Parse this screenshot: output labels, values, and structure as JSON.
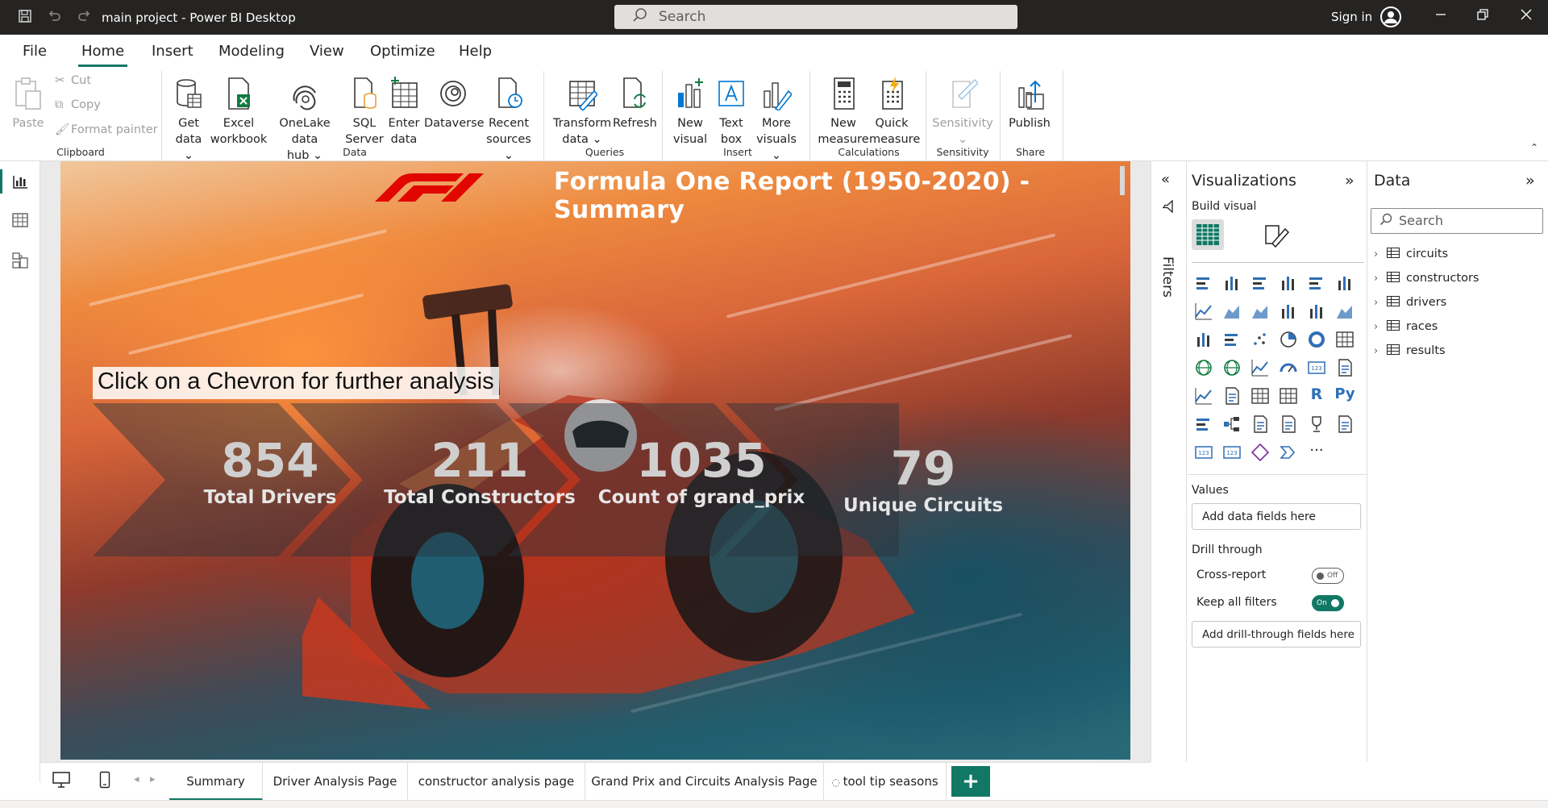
{
  "titlebar": {
    "title": "main project - Power BI Desktop",
    "search_placeholder": "Search",
    "signin": "Sign in"
  },
  "menu": {
    "tabs": [
      "File",
      "Home",
      "Insert",
      "Modeling",
      "View",
      "Optimize",
      "Help"
    ],
    "active": "Home"
  },
  "ribbon": {
    "clipboard": {
      "paste": "Paste",
      "cut": "Cut",
      "copy": "Copy",
      "format_painter": "Format painter",
      "group": "Clipboard"
    },
    "data": {
      "get_data": [
        "Get",
        "data"
      ],
      "excel": [
        "Excel",
        "workbook"
      ],
      "onelake": [
        "OneLake data",
        "hub"
      ],
      "sql": [
        "SQL",
        "Server"
      ],
      "enter": [
        "Enter",
        "data"
      ],
      "dataverse": "Dataverse",
      "recent": [
        "Recent",
        "sources"
      ],
      "group": "Data"
    },
    "queries": {
      "transform": [
        "Transform",
        "data"
      ],
      "refresh": "Refresh",
      "group": "Queries"
    },
    "insert": {
      "new_visual": [
        "New",
        "visual"
      ],
      "text_box": [
        "Text",
        "box"
      ],
      "more_visuals": [
        "More",
        "visuals"
      ],
      "group": "Insert"
    },
    "calculations": {
      "new_measure": [
        "New",
        "measure"
      ],
      "quick_measure": [
        "Quick",
        "measure"
      ],
      "group": "Calculations"
    },
    "sensitivity": {
      "label": "Sensitivity",
      "group": "Sensitivity"
    },
    "share": {
      "publish": "Publish",
      "group": "Share"
    }
  },
  "report": {
    "title": "Formula One Report (1950-2020) - Summary",
    "hint": "Click on a Chevron for further analysis",
    "kpis": [
      {
        "value": "854",
        "label": "Total Drivers"
      },
      {
        "value": "211",
        "label": "Total Constructors"
      },
      {
        "value": "1035",
        "label": "Count of grand_prix"
      },
      {
        "value": "79",
        "label": "Unique Circuits"
      }
    ],
    "colors": {
      "f1_red": "#e10600",
      "chevron": "#2f3640"
    }
  },
  "filters": {
    "label": "Filters"
  },
  "visualizations": {
    "header": "Visualizations",
    "build_visual": "Build visual",
    "values_label": "Values",
    "values_placeholder": "Add data fields here",
    "drill_through": "Drill through",
    "cross_report": "Cross-report",
    "cross_report_state": "Off",
    "keep_all_filters": "Keep all filters",
    "keep_all_filters_state": "On",
    "drillthrough_placeholder": "Add drill-through fields here",
    "r_label": "R",
    "py_label": "Py",
    "more": "···"
  },
  "data_pane": {
    "header": "Data",
    "search_placeholder": "Search",
    "tables": [
      "circuits",
      "constructors",
      "drivers",
      "races",
      "results"
    ]
  },
  "pages": {
    "tabs": [
      "Summary",
      "Driver Analysis Page",
      "constructor analysis page",
      "Grand Prix and Circuits Analysis Page",
      "tool tip seasons"
    ],
    "active": "Summary",
    "add": "+"
  },
  "theme": {
    "accent": "#117865",
    "titlebar": "#252423"
  }
}
